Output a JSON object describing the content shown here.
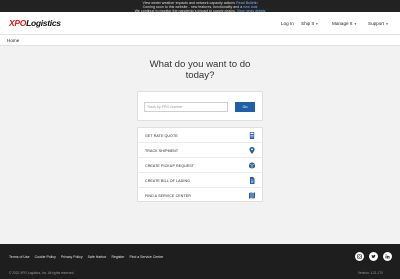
{
  "alert": {
    "line1_prefix": "View winter weather impacts and network capacity actions",
    "line1_link": "Read Bulletin",
    "line2_prefix": "Coming soon to this website - new features, functionality and a",
    "line2_link": "new look",
    "line3_prefix": "We continue to monitor the pandemic's impact to supply chains.",
    "line3_link": "View news details"
  },
  "header": {
    "logo_xpo": "XPO",
    "logo_logistics": "Logistics",
    "login": "Log In",
    "ship": "Ship It",
    "manage": "Manage It",
    "support": "Support"
  },
  "breadcrumb": {
    "home": "Home"
  },
  "main": {
    "heading_line1": "What do you want to do",
    "heading_line2": "today?",
    "search": {
      "placeholder": "Track by PRO number",
      "button": "Go"
    },
    "actions": [
      {
        "label": "GET RATE QUOTE",
        "icon": "calculator-icon"
      },
      {
        "label": "TRACK SHIPMENT",
        "icon": "map-pin-icon"
      },
      {
        "label": "CREATE PICKUP REQUEST",
        "icon": "package-icon"
      },
      {
        "label": "CREATE BILL OF LADING",
        "icon": "document-icon"
      },
      {
        "label": "FIND A SERVICE CENTER",
        "icon": "map-icon"
      }
    ]
  },
  "footer": {
    "links": [
      "Terms of Use",
      "Cookie Policy",
      "Privacy Policy",
      "Safe Harbor",
      "Register",
      "Find a Service Center"
    ],
    "copyright": "© 2022 XPO Logistics, Inc. All rights reserved.",
    "version": "Version: 1.21.170"
  },
  "colors": {
    "brand_red": "#d41f1f",
    "accent_blue": "#1f5fa8",
    "footer_bg": "#1e1e1e"
  }
}
